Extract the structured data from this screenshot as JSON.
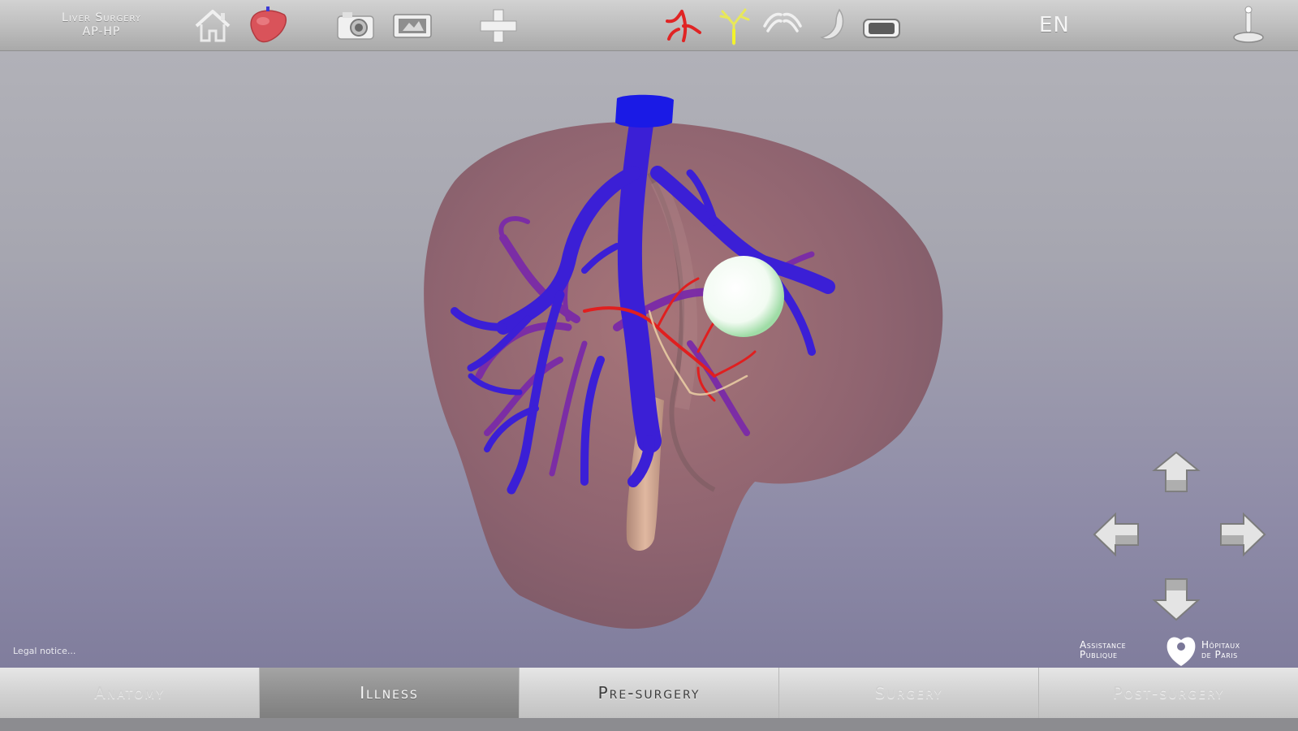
{
  "app": {
    "title_line1": "Liver Surgery",
    "title_line2": "AP-HP",
    "language": "EN"
  },
  "toolbar": {
    "icons": [
      "home-icon",
      "liver-icon",
      "camera-icon",
      "video-icon",
      "plus-icon",
      "artery-icon",
      "bile-duct-icon",
      "ribs-icon",
      "organ-icon",
      "bed-icon",
      "joystick-icon"
    ]
  },
  "viewport": {
    "legal_notice": "Legal notice...",
    "nav": [
      "arrow-up-icon",
      "arrow-left-icon",
      "arrow-right-icon",
      "arrow-down-icon"
    ]
  },
  "branding": {
    "left_line1": "Assistance",
    "left_line2": "Publique",
    "right_line1": "Hôpitaux",
    "right_line2": "de Paris"
  },
  "tabs": [
    {
      "label": "Anatomy",
      "state": "inactive"
    },
    {
      "label": "Illness",
      "state": "active"
    },
    {
      "label": "Pre-surgery",
      "state": "current"
    },
    {
      "label": "Surgery",
      "state": "inactive"
    },
    {
      "label": "Post-surgery",
      "state": "inactive"
    }
  ],
  "colors": {
    "vein": "#3b1fd6",
    "artery": "#e01f1f",
    "portal": "#7a2aa8",
    "liver": "#9a6a6e",
    "tumor": "#eaf5ea"
  }
}
